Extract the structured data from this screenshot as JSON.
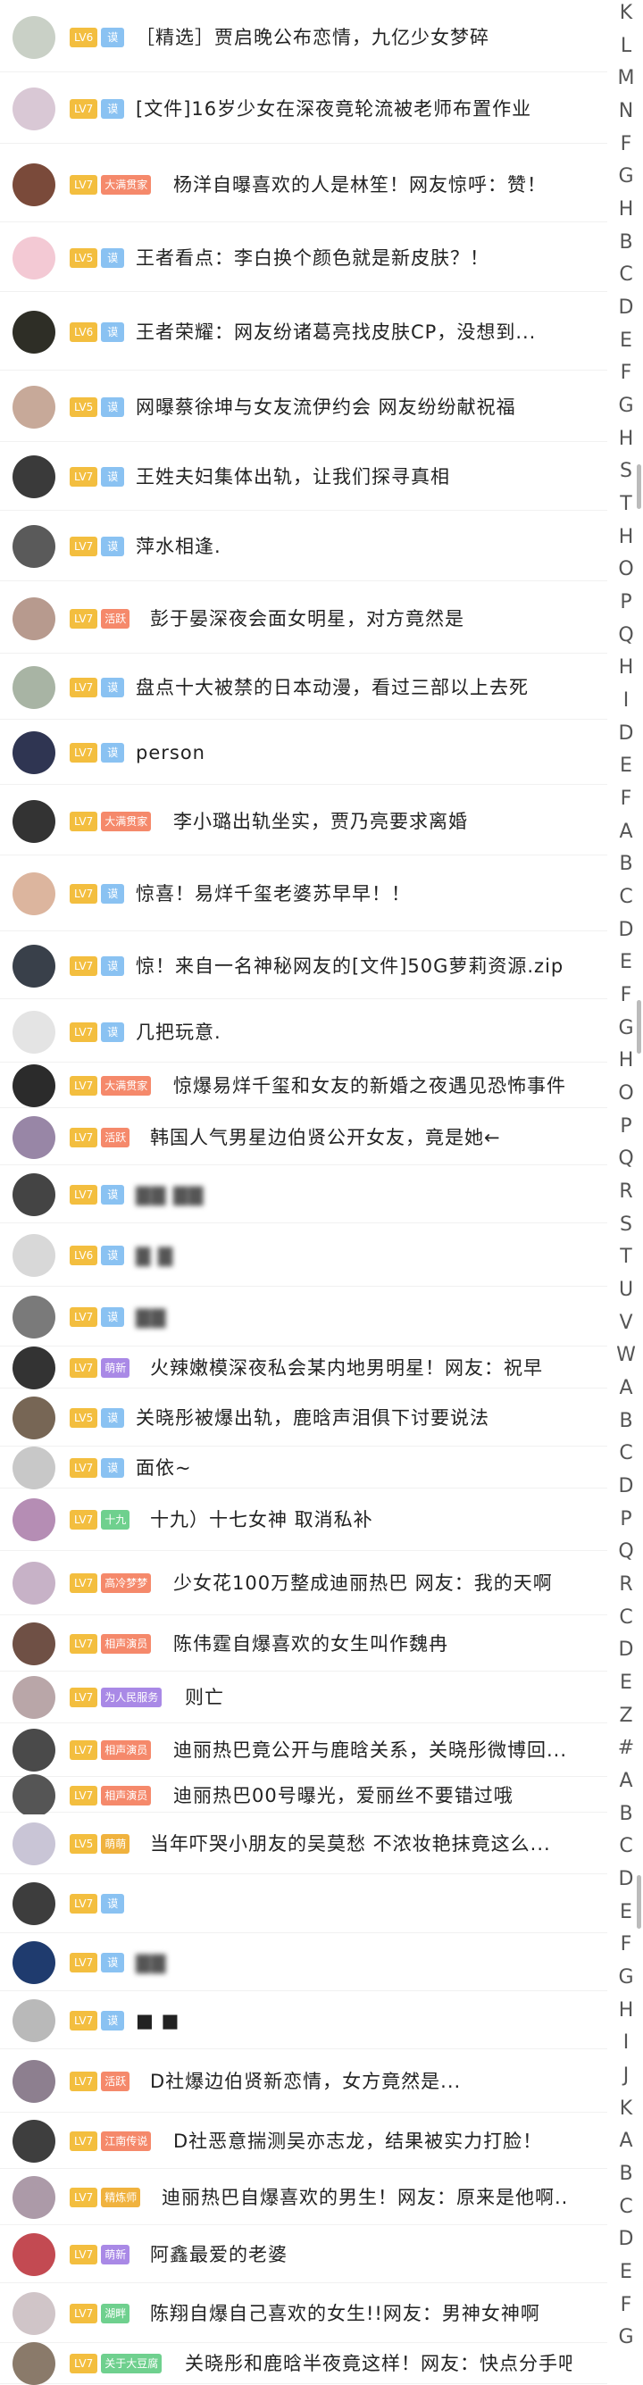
{
  "chat_list": [
    {
      "level": "LV6",
      "tag": "谟",
      "tag_color": "blue",
      "avatar_color": "#c9d0c6",
      "text": "［精选］贾启晚公布恋情，九亿少女梦碎",
      "style": ""
    },
    {
      "level": "LV7",
      "tag": "谟",
      "tag_color": "blue",
      "avatar_color": "#d9c8d5",
      "text": "[文件]16岁少女在深夜竟轮流被老师布置作业",
      "style": ""
    },
    {
      "level": "LV7",
      "tag": "大满贯家",
      "tag_color": "orange",
      "avatar_color": "#7a4a3a",
      "text": "杨洋自曝喜欢的人是林笙！网友惊呼：赞！",
      "style": ""
    },
    {
      "level": "LV5",
      "tag": "谟",
      "tag_color": "blue",
      "avatar_color": "#f3c9d4",
      "text": "王者看点：李白换个颜色就是新皮肤？！",
      "style": ""
    },
    {
      "level": "LV6",
      "tag": "谟",
      "tag_color": "blue",
      "avatar_color": "#2e2e26",
      "text": "王者荣耀：网友纷诸葛亮找皮肤CP，没想到...",
      "style": ""
    },
    {
      "level": "LV5",
      "tag": "谟",
      "tag_color": "blue",
      "avatar_color": "#c7a999",
      "text": "网曝蔡徐坤与女友流伊约会 网友纷纷献祝福",
      "style": ""
    },
    {
      "level": "LV7",
      "tag": "谟",
      "tag_color": "blue",
      "avatar_color": "#3a3a3a",
      "text": "王姓夫妇集体出轨，让我们探寻真相",
      "style": ""
    },
    {
      "level": "LV7",
      "tag": "谟",
      "tag_color": "blue",
      "avatar_color": "#5a5a5a",
      "text": "萍水相逢.",
      "style": ""
    },
    {
      "level": "LV7",
      "tag": "活跃",
      "tag_color": "orange",
      "avatar_color": "#b79a8e",
      "text": "彭于晏深夜会面女明星，对方竟然是",
      "style": ""
    },
    {
      "level": "LV7",
      "tag": "谟",
      "tag_color": "blue",
      "avatar_color": "#a8b4a4",
      "text": "盘点十大被禁的日本动漫，看过三部以上去死",
      "style": ""
    },
    {
      "level": "LV7",
      "tag": "谟",
      "tag_color": "blue",
      "avatar_color": "#2f3552",
      "text": "person",
      "style": ""
    },
    {
      "level": "LV7",
      "tag": "大满贯家",
      "tag_color": "orange",
      "avatar_color": "#333333",
      "text": "李小璐出轨坐实，贾乃亮要求离婚",
      "style": ""
    },
    {
      "level": "LV7",
      "tag": "谟",
      "tag_color": "blue",
      "avatar_color": "#dcb59e",
      "text": "惊喜！易烊千玺老婆苏早早！！",
      "style": ""
    },
    {
      "level": "LV7",
      "tag": "谟",
      "tag_color": "blue",
      "avatar_color": "#39404a",
      "text": "惊！来自一名神秘网友的[文件]50G萝莉资源.zip",
      "style": ""
    },
    {
      "level": "LV7",
      "tag": "谟",
      "tag_color": "blue",
      "avatar_color": "#e4e4e4",
      "text": "几把玩意.",
      "style": ""
    },
    {
      "level": "LV7",
      "tag": "大满贯家",
      "tag_color": "orange",
      "avatar_color": "#2b2b2b",
      "text": "惊爆易烊千玺和女友的新婚之夜遇见恐怖事件",
      "style": ""
    },
    {
      "level": "LV7",
      "tag": "活跃",
      "tag_color": "orange",
      "avatar_color": "#9886a6",
      "text": "韩国人气男星边伯贤公开女友，竟是她←",
      "style": ""
    },
    {
      "level": "LV7",
      "tag": "谟",
      "tag_color": "blue",
      "avatar_color": "#444444",
      "text": "▇▇ ▇▇",
      "style": "blur"
    },
    {
      "level": "LV6",
      "tag": "谟",
      "tag_color": "blue",
      "avatar_color": "#d8d8d8",
      "text": "▇ ▇",
      "style": "blur"
    },
    {
      "level": "LV7",
      "tag": "谟",
      "tag_color": "blue",
      "avatar_color": "#7a7a7a",
      "text": "▇▇",
      "style": "blur"
    },
    {
      "level": "LV7",
      "tag": "萌新",
      "tag_color": "purple",
      "avatar_color": "#333333",
      "text": "火辣嫩模深夜私会某内地男明星！网友：祝早",
      "style": ""
    },
    {
      "level": "LV5",
      "tag": "谟",
      "tag_color": "blue",
      "avatar_color": "#776655",
      "text": "关晓彤被爆出轨，鹿晗声泪俱下讨要说法",
      "style": ""
    },
    {
      "level": "LV7",
      "tag": "谟",
      "tag_color": "blue",
      "avatar_color": "#c8c8c8",
      "text": "面依~",
      "style": ""
    },
    {
      "level": "LV7",
      "tag": "十九",
      "tag_color": "green",
      "avatar_color": "#b58db4",
      "text": "十九）十七女神 取消私补",
      "style": ""
    },
    {
      "level": "LV7",
      "tag": "高冷梦梦",
      "tag_color": "orange",
      "avatar_color": "#c7b2c7",
      "text": "少女花100万整成迪丽热巴 网友：我的天啊",
      "style": ""
    },
    {
      "level": "LV7",
      "tag": "相声演员",
      "tag_color": "orange",
      "avatar_color": "#6f5045",
      "text": "陈伟霆自爆喜欢的女生叫作魏冉",
      "style": ""
    },
    {
      "level": "LV7",
      "tag": "为人民服务",
      "tag_color": "purple",
      "avatar_color": "#b9a6a8",
      "text": "则亡",
      "style": ""
    },
    {
      "level": "LV7",
      "tag": "相声演员",
      "tag_color": "orange",
      "avatar_color": "#4a4a4a",
      "text": "迪丽热巴竟公开与鹿晗关系，关晓彤微博回...",
      "style": ""
    },
    {
      "level": "LV7",
      "tag": "相声演员",
      "tag_color": "orange",
      "avatar_color": "#555555",
      "text": "迪丽热巴00号曝光，爱丽丝不要错过哦",
      "style": ""
    },
    {
      "level": "LV5",
      "tag": "萌萌",
      "tag_color": "gold",
      "avatar_color": "#c9c5d6",
      "text": "当年吓哭小朋友的吴莫愁 不浓妆艳抹竟这么...",
      "style": ""
    },
    {
      "level": "LV7",
      "tag": "谟",
      "tag_color": "blue",
      "avatar_color": "#3d3d3d",
      "text": "",
      "style": "blur"
    },
    {
      "level": "LV7",
      "tag": "谟",
      "tag_color": "blue",
      "avatar_color": "#1f3b6e",
      "text": "▇▇",
      "style": "blur"
    },
    {
      "level": "LV7",
      "tag": "谟",
      "tag_color": "blue",
      "avatar_color": "#b9b9b9",
      "text": "■ ■",
      "style": ""
    },
    {
      "level": "LV7",
      "tag": "活跃",
      "tag_color": "orange",
      "avatar_color": "#8d7f8f",
      "text": "D社爆边伯贤新恋情，女方竟然是...",
      "style": ""
    },
    {
      "level": "LV7",
      "tag": "江南传说",
      "tag_color": "orange",
      "avatar_color": "#3e3e3e",
      "text": "D社恶意揣测吴亦志龙，结果被实力打脸！",
      "style": ""
    },
    {
      "level": "LV7",
      "tag": "精炼师",
      "tag_color": "gold",
      "avatar_color": "#ac9aa8",
      "text": "迪丽热巴自爆喜欢的男生！网友：原来是他啊..",
      "style": ""
    },
    {
      "level": "LV7",
      "tag": "萌新",
      "tag_color": "purple",
      "avatar_color": "#c34a52",
      "text": "阿鑫最爱的老婆",
      "style": ""
    },
    {
      "level": "LV7",
      "tag": "湖畔",
      "tag_color": "green",
      "avatar_color": "#d0c5c8",
      "text": "陈翔自爆自己喜欢的女生!!网友：男神女神啊",
      "style": ""
    },
    {
      "level": "LV7",
      "tag": "关于大豆腐",
      "tag_color": "green",
      "avatar_color": "#8a7a6a",
      "text": "关晓彤和鹿晗半夜竟这样！网友：快点分手吧",
      "style": ""
    }
  ],
  "index_letters": [
    "K",
    "L",
    "M",
    "N",
    "F",
    "G",
    "H",
    "B",
    "C",
    "D",
    "E",
    "F",
    "G",
    "H",
    "S",
    "T",
    "H",
    "O",
    "P",
    "Q",
    "H",
    "I",
    "D",
    "E",
    "F",
    "A",
    "B",
    "C",
    "D",
    "E",
    "F",
    "G",
    "H",
    "O",
    "P",
    "Q",
    "R",
    "S",
    "T",
    "U",
    "V",
    "W",
    "A",
    "B",
    "C",
    "D",
    "P",
    "Q",
    "R",
    "C",
    "D",
    "E",
    "Z",
    "#",
    "A",
    "B",
    "C",
    "D",
    "E",
    "F",
    "G",
    "H",
    "I",
    "J",
    "K",
    "A",
    "B",
    "C",
    "D",
    "E",
    "F",
    "G"
  ]
}
